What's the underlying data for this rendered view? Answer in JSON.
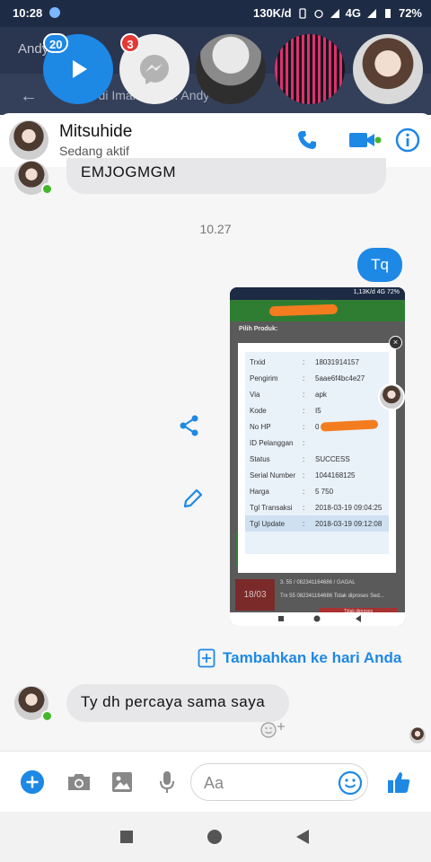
{
  "status_bar": {
    "time": "10:28",
    "network_speed": "130K/d",
    "network_type": "4G",
    "battery": "72%"
  },
  "background_app": {
    "tab_text": "Andy Moda",
    "search_hint": "Cari di Iman dan ... Andy"
  },
  "chat_heads": {
    "video_count": "20",
    "messenger_count": "3"
  },
  "header": {
    "contact_name": "Mitsuhide",
    "contact_status": "Sedang aktif"
  },
  "messages": {
    "first_incoming": "EMJOGMGM",
    "time_separator": "10.27",
    "outgoing_text": "Tq",
    "last_incoming": "Ty dh percaya sama saya"
  },
  "shared_screenshot": {
    "status_right": "1,13K/d  4G  72%",
    "product_label": "Pilih Produk:",
    "close_glyph": "×",
    "rows": [
      {
        "key": "Trxid",
        "value": "18031914157"
      },
      {
        "key": "Pengirim",
        "value": "5aae6f4bc4e27"
      },
      {
        "key": "Via",
        "value": "apk"
      },
      {
        "key": "Kode",
        "value": "I5"
      },
      {
        "key": "No HP",
        "value": "0"
      },
      {
        "key": "ID Pelanggan",
        "value": ""
      },
      {
        "key": "Status",
        "value": "SUCCESS"
      },
      {
        "key": "Serial Number",
        "value": "1044168125"
      },
      {
        "key": "Harga",
        "value": "5 750"
      },
      {
        "key": "Tgl Transaksi",
        "value": "2018-03-19 09:04:25"
      },
      {
        "key": "Tgl Update",
        "value": "2018-03-19 09:12:08"
      }
    ],
    "list_date": "18/03",
    "list_line_1": "3. 55 / 082341164686 / GAGAL",
    "list_line_2": "Trx 55 082341164686 Tidak diproses Sed...",
    "list_button": "Tidak diproses"
  },
  "story": {
    "add_label": "Tambahkan ke hari Anda"
  },
  "composer": {
    "placeholder": "Aa"
  },
  "colors": {
    "accent": "#1e88e5",
    "online": "#42b72a",
    "incoming_bubble": "#e7e7e9"
  },
  "icons": [
    "play-icon",
    "messenger-icon",
    "phone-icon",
    "video-camera-icon",
    "info-icon",
    "share-icon",
    "edit-icon",
    "plus-square-icon",
    "emoji-add-icon",
    "plus-circle-icon",
    "camera-icon",
    "image-icon",
    "microphone-icon",
    "smile-icon",
    "thumbs-up-icon",
    "nav-square-icon",
    "nav-circle-icon",
    "nav-back-icon"
  ]
}
